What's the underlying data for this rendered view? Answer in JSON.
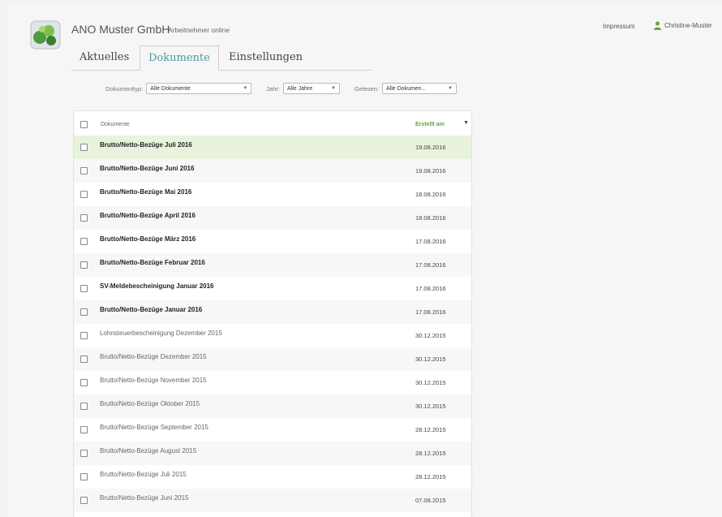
{
  "header": {
    "company": "ANO Muster GmbH",
    "subtitle": "Arbeitnehmer online",
    "impressum": "Impressum",
    "user": "Christine-Muster"
  },
  "tabs": [
    {
      "label": "Aktuelles",
      "active": false
    },
    {
      "label": "Dokumente",
      "active": true
    },
    {
      "label": "Einstellungen",
      "active": false
    }
  ],
  "filters": {
    "type_label": "Dokumenttyp:",
    "type_value": "Alle Dokumente",
    "year_label": "Jahr:",
    "year_value": "Alle Jahre",
    "read_label": "Gelesen:",
    "read_value": "Alle Dokumen..."
  },
  "table": {
    "col_documents": "Dokumente",
    "col_created": "Erstellt am",
    "sort_icon": "chevron-down-icon",
    "rows": [
      {
        "title": "Brutto/Netto-Bezüge Juli 2016",
        "date": "19.08.2016",
        "unread": true,
        "selected": true
      },
      {
        "title": "Brutto/Netto-Bezüge Juni 2016",
        "date": "19.08.2016",
        "unread": true,
        "selected": false
      },
      {
        "title": "Brutto/Netto-Bezüge Mai 2016",
        "date": "18.08.2016",
        "unread": true,
        "selected": false
      },
      {
        "title": "Brutto/Netto-Bezüge April 2016",
        "date": "18.08.2016",
        "unread": true,
        "selected": false
      },
      {
        "title": "Brutto/Netto-Bezüge März 2016",
        "date": "17.08.2016",
        "unread": true,
        "selected": false
      },
      {
        "title": "Brutto/Netto-Bezüge Februar 2016",
        "date": "17.08.2016",
        "unread": true,
        "selected": false
      },
      {
        "title": "SV-Meldebescheinigung Januar 2016",
        "date": "17.08.2016",
        "unread": true,
        "selected": false
      },
      {
        "title": "Brutto/Netto-Bezüge Januar 2016",
        "date": "17.08.2016",
        "unread": true,
        "selected": false
      },
      {
        "title": "Lohnsteuerbescheinigung Dezember 2015",
        "date": "30.12.2015",
        "unread": false,
        "selected": false
      },
      {
        "title": "Brutto/Netto-Bezüge Dezember 2015",
        "date": "30.12.2015",
        "unread": false,
        "selected": false
      },
      {
        "title": "Brutto/Netto-Bezüge November 2015",
        "date": "30.12.2015",
        "unread": false,
        "selected": false
      },
      {
        "title": "Brutto/Netto-Bezüge Oktober 2015",
        "date": "30.12.2015",
        "unread": false,
        "selected": false
      },
      {
        "title": "Brutto/Netto-Bezüge September 2015",
        "date": "28.12.2015",
        "unread": false,
        "selected": false
      },
      {
        "title": "Brutto/Netto-Bezüge August 2015",
        "date": "28.12.2015",
        "unread": false,
        "selected": false
      },
      {
        "title": "Brutto/Netto-Bezüge Juli 2015",
        "date": "28.12.2015",
        "unread": false,
        "selected": false
      },
      {
        "title": "Brutto/Netto-Bezüge Juni 2015",
        "date": "07.08.2015",
        "unread": false,
        "selected": false
      }
    ]
  },
  "colors": {
    "accent": "#4a9aa8",
    "brand_green": "#6aa33a",
    "selected_row": "#e8f2dd"
  }
}
